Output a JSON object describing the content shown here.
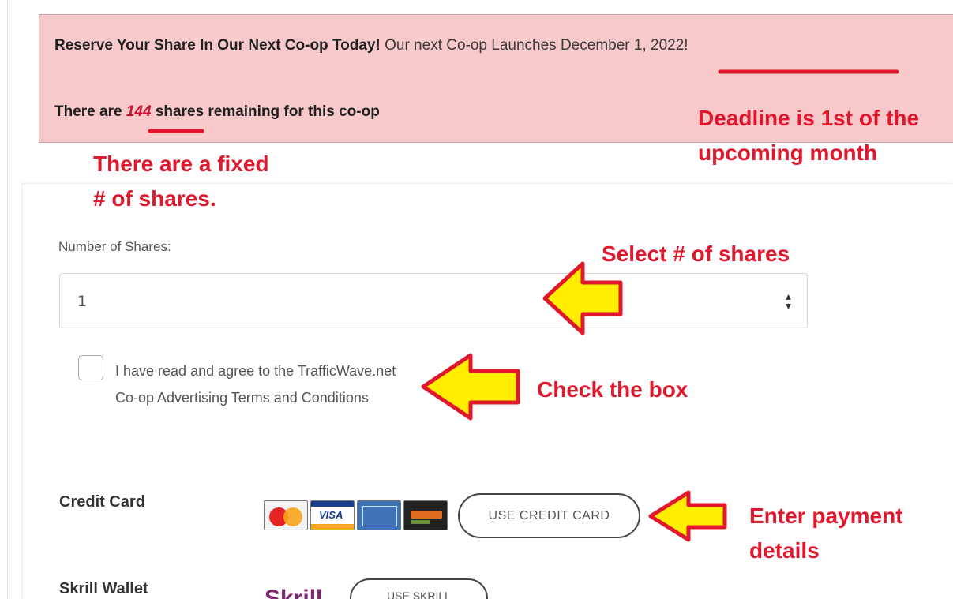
{
  "banner": {
    "headline": "Reserve Your Share In Our Next Co-op Today!",
    "launch_text": "Our next Co-op Launches December 1, 2022!",
    "remaining_prefix": "There are",
    "remaining_count": "144",
    "remaining_suffix": "shares remaining for this co-op"
  },
  "form": {
    "shares_label": "Number of Shares:",
    "shares_value": "1",
    "terms_text": "I have read and agree to the TrafficWave.net Co-op Advertising Terms and Conditions",
    "terms_checked": false
  },
  "payment": {
    "credit_card_label": "Credit Card",
    "credit_card_button": "USE CREDIT CARD",
    "card_brands": [
      "mastercard",
      "visa",
      "american-express",
      "discover"
    ],
    "skrill_label": "Skrill Wallet",
    "skrill_logo": "Skrill",
    "skrill_button": "USE SKRILL"
  },
  "annotations": {
    "deadline_line1": "Deadline is 1st of the",
    "deadline_line2": "upcoming month",
    "fixed_line1": "There are a fixed",
    "fixed_line2": "# of shares.",
    "select_shares": "Select # of shares",
    "check_box": "Check the box",
    "payment_line1": "Enter payment",
    "payment_line2": "details"
  },
  "colors": {
    "banner_bg": "#f8c9ca",
    "annotation_red": "#e0182d",
    "arrow_fill": "#ffee00"
  }
}
